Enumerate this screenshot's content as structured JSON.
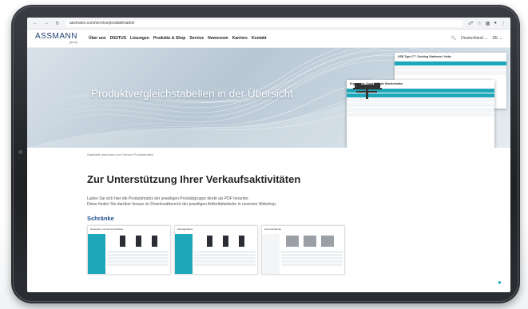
{
  "browser": {
    "url": "assmann.com/service/produktmatrix/",
    "icons": [
      "back-icon",
      "forward-icon",
      "reload-icon"
    ]
  },
  "header": {
    "logo_main": "ASSMANN",
    "logo_sub": "group",
    "nav": [
      "Über uns",
      "DIGITUS",
      "Lösungen",
      "Produkte & Shop",
      "Service",
      "Newsroom",
      "Karriere",
      "Kontakt"
    ],
    "language": "Deutschland",
    "lang_code": "DE"
  },
  "hero": {
    "title": "Produktvergleichstabellen in der Übersicht",
    "doc_back_title": "USB Type-C™ Docking Stationen / Hubs",
    "doc_front_title": "Ergonomie: Quad & Triple Monitorhalter"
  },
  "breadcrumb": "Startseite  assmann.com  Service  Produktmatrix",
  "section": {
    "title": "Zur Unterstützung Ihrer Verkaufsaktivitäten",
    "intro_line1": "Laden Sie sich hier die Produktmatrix der jeweiligen Produktgruppe direkt als PDF herunter.",
    "intro_line2": "Diese finden Sie darüber hinaus im Downloadbereich der jeweiligen Artikeldetailseite in unserem Webshop.",
    "subtitle": "Schränke"
  },
  "thumbnails": [
    {
      "title": "Netzwerk- und Serverschränke"
    },
    {
      "title": "Wandgehäuse"
    },
    {
      "title": "Serverschränke"
    }
  ],
  "colors": {
    "brand": "#1f3d6b",
    "accent": "#1ea6b9",
    "subtitle": "#1f4e8c"
  }
}
